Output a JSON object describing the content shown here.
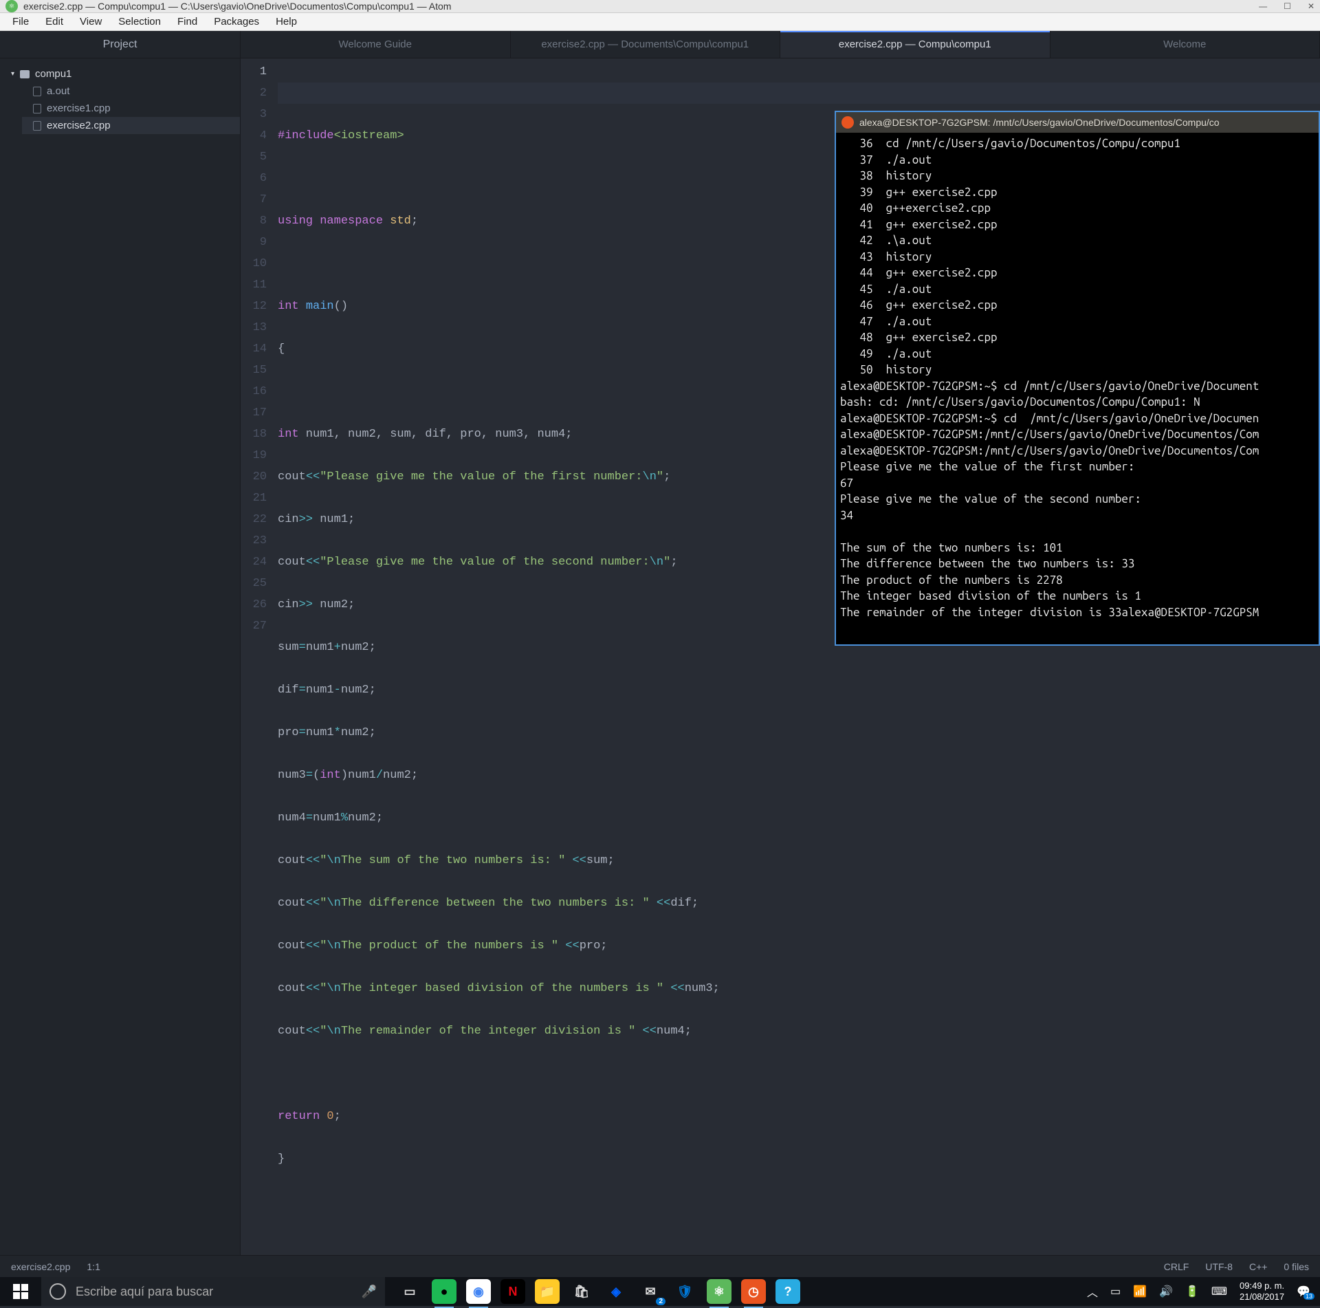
{
  "window": {
    "title": "exercise2.cpp — Compu\\compu1 — C:\\Users\\gavio\\OneDrive\\Documentos\\Compu\\compu1 — Atom"
  },
  "menu": {
    "file": "File",
    "edit": "Edit",
    "view": "View",
    "selection": "Selection",
    "find": "Find",
    "packages": "Packages",
    "help": "Help"
  },
  "project_header": "Project",
  "tabs": {
    "t1": "Welcome Guide",
    "t2": "exercise2.cpp — Documents\\Compu\\compu1",
    "t3": "exercise2.cpp — Compu\\compu1",
    "t4": "Welcome"
  },
  "tree": {
    "root": "compu1",
    "f1": "a.out",
    "f2": "exercise1.cpp",
    "f3": "exercise2.cpp"
  },
  "status": {
    "file": "exercise2.cpp",
    "pos": "1:1",
    "eol": "CRLF",
    "enc": "UTF-8",
    "lang": "C++",
    "files": "0 files"
  },
  "terminal": {
    "title": "alexa@DESKTOP-7G2GPSM: /mnt/c/Users/gavio/OneDrive/Documentos/Compu/co",
    "body": "   36  cd /mnt/c/Users/gavio/Documentos/Compu/compu1\n   37  ./a.out\n   38  history\n   39  g++ exercise2.cpp\n   40  g++exercise2.cpp\n   41  g++ exercise2.cpp\n   42  .\\a.out\n   43  history\n   44  g++ exercise2.cpp\n   45  ./a.out\n   46  g++ exercise2.cpp\n   47  ./a.out\n   48  g++ exercise2.cpp\n   49  ./a.out\n   50  history\nalexa@DESKTOP-7G2GPSM:~$ cd /mnt/c/Users/gavio/OneDrive/Document\nbash: cd: /mnt/c/Users/gavio/Documentos/Compu/Compu1: N\nalexa@DESKTOP-7G2GPSM:~$ cd  /mnt/c/Users/gavio/OneDrive/Documen\nalexa@DESKTOP-7G2GPSM:/mnt/c/Users/gavio/OneDrive/Documentos/Com\nalexa@DESKTOP-7G2GPSM:/mnt/c/Users/gavio/OneDrive/Documentos/Com\nPlease give me the value of the first number:\n67\nPlease give me the value of the second number:\n34\n\nThe sum of the two numbers is: 101\nThe difference between the two numbers is: 33\nThe product of the numbers is 2278\nThe integer based division of the numbers is 1\nThe remainder of the integer division is 33alexa@DESKTOP-7G2GPSM"
  },
  "taskbar": {
    "search_placeholder": "Escribe aquí para buscar",
    "time": "09:49 p. m.",
    "date": "21/08/2017",
    "mail_badge": "2",
    "notif_badge": "13"
  },
  "code": {
    "lines": [
      "1",
      "2",
      "3",
      "4",
      "5",
      "6",
      "7",
      "8",
      "9",
      "10",
      "11",
      "12",
      "13",
      "14",
      "15",
      "16",
      "17",
      "18",
      "19",
      "20",
      "21",
      "22",
      "23",
      "24",
      "25",
      "26",
      "27"
    ]
  }
}
